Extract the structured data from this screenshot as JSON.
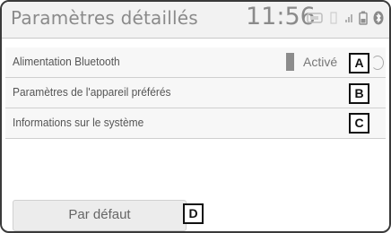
{
  "header": {
    "title": "Paramètres détaillés",
    "clock": "11:56",
    "status_icons": [
      "sd-card-icon",
      "phone-icon",
      "signal-icon",
      "battery-icon",
      "bluetooth-icon"
    ]
  },
  "rows": [
    {
      "label": "Alimentation Bluetooth",
      "value": "Activé",
      "callout": "A"
    },
    {
      "label": "Paramètres de l'appareil préférés",
      "callout": "B"
    },
    {
      "label": "Informations sur le système",
      "callout": "C"
    }
  ],
  "footer": {
    "default_label": "Par défaut",
    "callout": "D"
  },
  "colors": {
    "header_bg": "#f2f2f2",
    "text_gray": "#8a8a8a",
    "row_bg": "#f7f7f7",
    "status_block": "#8c8c8c"
  }
}
